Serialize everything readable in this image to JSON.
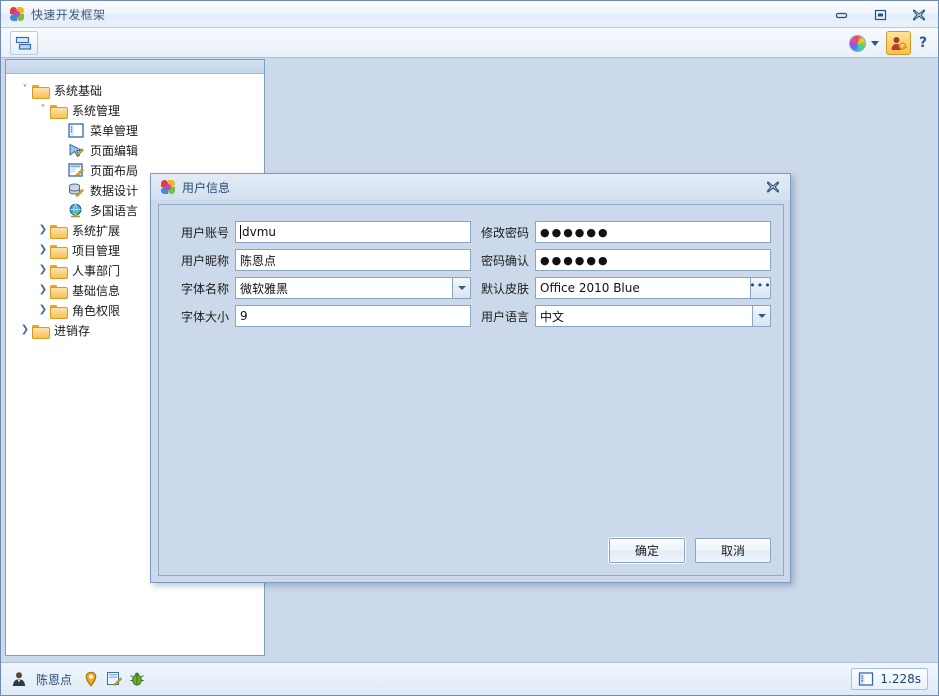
{
  "window": {
    "title": "快速开发框架",
    "icon": "pinwheel-icon",
    "controls": {
      "minimize": "minimize-icon",
      "maximize": "maximize-icon",
      "close": "close-icon"
    }
  },
  "toolbar": {
    "layout_button": "panel-layout-icon",
    "color_wheel": "color-wheel-icon",
    "color_dropdown": "chevron-down-icon",
    "user_button": "user-account-icon",
    "help_button": "?"
  },
  "tree": {
    "items": [
      {
        "label": "系统基础",
        "level": 0,
        "expander": "chevron-down",
        "icon": "folder-icon"
      },
      {
        "label": "系统管理",
        "level": 1,
        "expander": "chevron-down",
        "icon": "folder-icon"
      },
      {
        "label": "菜单管理",
        "level": 2,
        "expander": "none",
        "icon": "menu-management-icon"
      },
      {
        "label": "页面编辑",
        "level": 2,
        "expander": "none",
        "icon": "page-edit-icon"
      },
      {
        "label": "页面布局",
        "level": 2,
        "expander": "none",
        "icon": "page-layout-icon"
      },
      {
        "label": "数据设计",
        "level": 2,
        "expander": "none",
        "icon": "data-design-icon"
      },
      {
        "label": "多国语言",
        "level": 2,
        "expander": "none",
        "icon": "globe-icon"
      },
      {
        "label": "系统扩展",
        "level": 1,
        "expander": "chevron-right",
        "icon": "folder-icon"
      },
      {
        "label": "项目管理",
        "level": 1,
        "expander": "chevron-right",
        "icon": "folder-icon"
      },
      {
        "label": "人事部门",
        "level": 1,
        "expander": "chevron-right",
        "icon": "folder-icon"
      },
      {
        "label": "基础信息",
        "level": 1,
        "expander": "chevron-right",
        "icon": "folder-icon"
      },
      {
        "label": "角色权限",
        "level": 1,
        "expander": "chevron-right",
        "icon": "folder-icon"
      },
      {
        "label": "进销存",
        "level": 0,
        "expander": "chevron-right",
        "icon": "folder-icon"
      }
    ]
  },
  "dialog": {
    "title": "用户信息",
    "icon": "pinwheel-icon",
    "close": "close-icon",
    "fields": {
      "account": {
        "label": "用户账号",
        "value": "dvmu",
        "type": "text"
      },
      "nickname": {
        "label": "用户昵称",
        "value": "陈恩点",
        "type": "text"
      },
      "font_name": {
        "label": "字体名称",
        "value": "微软雅黑",
        "type": "combo"
      },
      "font_size": {
        "label": "字体大小",
        "value": "9",
        "type": "text"
      },
      "password": {
        "label": "修改密码",
        "value": "●●●●●●",
        "type": "password"
      },
      "password_confirm": {
        "label": "密码确认",
        "value": "●●●●●●",
        "type": "password"
      },
      "skin": {
        "label": "默认皮肤",
        "value": "Office 2010 Blue",
        "type": "ellipsis"
      },
      "language": {
        "label": "用户语言",
        "value": "中文",
        "type": "combo"
      }
    },
    "buttons": {
      "ok": "确定",
      "cancel": "取消"
    }
  },
  "statusbar": {
    "user_icon": "user-icon",
    "user_name": "陈恩点",
    "pin_icon": "location-pin-icon",
    "wizard_icon": "wizard-icon",
    "bug_icon": "bug-icon",
    "panel_icon": "panel-icon",
    "elapsed": "1.228s"
  },
  "colors": {
    "workspace_bg": "#ccd9ea",
    "title_text": "#3d5a80",
    "folder": "#f4c158",
    "accent": "#7c9bc2"
  }
}
